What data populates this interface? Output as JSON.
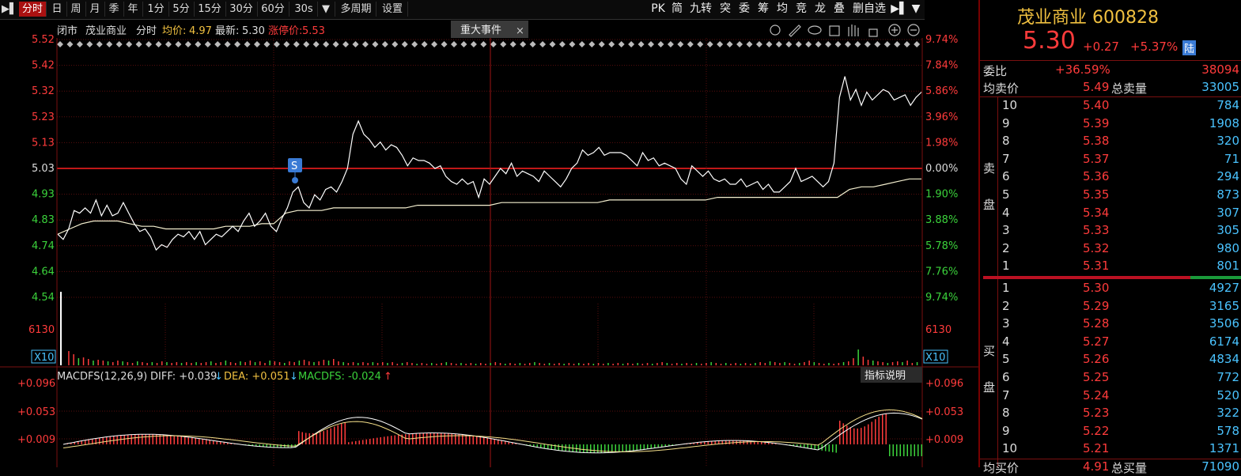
{
  "toolbar": {
    "left_tabs": [
      "分时",
      "日",
      "周",
      "月",
      "季",
      "年",
      "1分",
      "5分",
      "15分",
      "30分",
      "60分",
      "30s",
      "多周期",
      "设置"
    ],
    "right_tools": [
      "PK",
      "简",
      "九转",
      "突",
      "委",
      "筹",
      "均",
      "竞",
      "龙",
      "叠",
      "删自选"
    ]
  },
  "header": {
    "status": "闭市",
    "name": "茂业商业",
    "mode": "分时",
    "avg_label": "均价:",
    "avg_value": "4.97",
    "last_label": "最新:",
    "last_value": "5.30",
    "limit_up_label": "涨停价:",
    "limit_up_value": "5.53",
    "event_tab": "重大事件",
    "event_close": "×"
  },
  "price_axis": {
    "left": [
      "5.52",
      "5.42",
      "5.32",
      "5.23",
      "5.13",
      "5.03",
      "4.93",
      "4.83",
      "4.74",
      "4.64",
      "4.54"
    ],
    "right": [
      "9.74%",
      "7.84%",
      "5.86%",
      "3.96%",
      "1.98%",
      "0.00%",
      "1.90%",
      "3.88%",
      "5.78%",
      "7.76%",
      "9.74%"
    ],
    "volume_label": "6130",
    "volume_scale": "X10",
    "signal_badge": "S"
  },
  "macd": {
    "title": "MACDFS(12,26,9)",
    "diff_label": "DIFF: +0.039",
    "diff_arrow": "↓",
    "dea_label": "DEA: +0.051",
    "dea_arrow": "↓",
    "macdfs_label": "MACDFS: -0.024",
    "macdfs_arrow": "↑",
    "help_button": "指标说明",
    "axis": [
      "+0.096",
      "+0.053",
      "+0.009"
    ]
  },
  "quote": {
    "title": "茂业商业 600828",
    "price": "5.30",
    "change": "+0.27",
    "change_pct": "+5.37%",
    "badge": "陆",
    "wb_label": "委比",
    "wb_value": "+36.59%",
    "wb_volume": "38094",
    "avg_ask_label": "均卖价",
    "avg_ask_value": "5.49",
    "total_ask_label": "总卖量",
    "total_ask_value": "33005",
    "sell_label_1": "卖",
    "sell_label_2": "盘",
    "buy_label_1": "买",
    "buy_label_2": "盘",
    "bottom_left": "均买价",
    "bottom_mid": "4.91",
    "bottom_label": "总买量",
    "bottom_val": "71090",
    "asks": [
      {
        "level": "10",
        "price": "5.40",
        "vol": "784"
      },
      {
        "level": "9",
        "price": "5.39",
        "vol": "1908"
      },
      {
        "level": "8",
        "price": "5.38",
        "vol": "320"
      },
      {
        "level": "7",
        "price": "5.37",
        "vol": "71"
      },
      {
        "level": "6",
        "price": "5.36",
        "vol": "294"
      },
      {
        "level": "5",
        "price": "5.35",
        "vol": "873"
      },
      {
        "level": "4",
        "price": "5.34",
        "vol": "307"
      },
      {
        "level": "3",
        "price": "5.33",
        "vol": "305"
      },
      {
        "level": "2",
        "price": "5.32",
        "vol": "980"
      },
      {
        "level": "1",
        "price": "5.31",
        "vol": "801"
      }
    ],
    "bids": [
      {
        "level": "1",
        "price": "5.30",
        "vol": "4927"
      },
      {
        "level": "2",
        "price": "5.29",
        "vol": "3165"
      },
      {
        "level": "3",
        "price": "5.28",
        "vol": "3506"
      },
      {
        "level": "4",
        "price": "5.27",
        "vol": "6174"
      },
      {
        "level": "5",
        "price": "5.26",
        "vol": "4834"
      },
      {
        "level": "6",
        "price": "5.25",
        "vol": "772"
      },
      {
        "level": "7",
        "price": "5.24",
        "vol": "520"
      },
      {
        "level": "8",
        "price": "5.23",
        "vol": "322"
      },
      {
        "level": "9",
        "price": "5.22",
        "vol": "578"
      },
      {
        "level": "10",
        "price": "5.21",
        "vol": "1371"
      }
    ]
  },
  "chart_data": {
    "type": "line",
    "series": [
      {
        "values": [
          4.78,
          4.76,
          4.8,
          4.87,
          4.86,
          4.88,
          4.86,
          4.91,
          4.85,
          4.89,
          4.85,
          4.86,
          4.9,
          4.86,
          4.82,
          4.79,
          4.8,
          4.77,
          4.72,
          4.74,
          4.73,
          4.76,
          4.78,
          4.77,
          4.79,
          4.76,
          4.79,
          4.74,
          4.76,
          4.78,
          4.77,
          4.79,
          4.81,
          4.79,
          4.83,
          4.86,
          4.81,
          4.83,
          4.86,
          4.81,
          4.79,
          4.84,
          4.88,
          4.94,
          4.96,
          4.9,
          4.88,
          4.93,
          4.91,
          4.95,
          4.96,
          4.94,
          4.98,
          5.03,
          5.16,
          5.21,
          5.16,
          5.14,
          5.11,
          5.13,
          5.1,
          5.12,
          5.11,
          5.08,
          5.04,
          5.07,
          5.06,
          5.06,
          5.05,
          5.03,
          5.04,
          5.0,
          4.98,
          4.97,
          4.99,
          4.97,
          4.98,
          4.92,
          4.99,
          4.97,
          5.0,
          5.03,
          5.01,
          5.05,
          5.0,
          5.02,
          5.01,
          5.0,
          4.98,
          5.02,
          5.0,
          4.98,
          4.96,
          4.99,
          5.03,
          5.05,
          5.1,
          5.08,
          5.09,
          5.11,
          5.08,
          5.09,
          5.09,
          5.09,
          5.08,
          5.06,
          5.04,
          5.09,
          5.06,
          5.07,
          5.04,
          5.05,
          5.04,
          5.03,
          4.99,
          4.97,
          5.04,
          5.02,
          5.0,
          5.02,
          4.99,
          4.98,
          4.99,
          4.97,
          4.97,
          4.99,
          4.96,
          4.97,
          4.98,
          4.95,
          4.97,
          4.94,
          4.94,
          4.96,
          4.98,
          5.03,
          4.98,
          4.99,
          5.0,
          4.98,
          4.96,
          4.98,
          5.05,
          5.3,
          5.38,
          5.29,
          5.33,
          5.27,
          5.32,
          5.29,
          5.31,
          5.33,
          5.32,
          5.29,
          5.3,
          5.31,
          5.27,
          5.3,
          5.32
        ]
      },
      {
        "values": [
          4.78,
          4.8,
          4.82,
          4.83,
          4.83,
          4.83,
          4.82,
          4.81,
          4.81,
          4.8,
          4.8,
          4.8,
          4.8,
          4.8,
          4.81,
          4.81,
          4.81,
          4.82,
          4.82,
          4.86,
          4.87,
          4.87,
          4.87,
          4.88,
          4.88,
          4.88,
          4.88,
          4.88,
          4.88,
          4.88,
          4.89,
          4.89,
          4.89,
          4.89,
          4.89,
          4.89,
          4.89,
          4.9,
          4.9,
          4.9,
          4.9,
          4.9,
          4.9,
          4.9,
          4.9,
          4.9,
          4.91,
          4.91,
          4.91,
          4.91,
          4.91,
          4.91,
          4.91,
          4.91,
          4.91,
          4.92,
          4.92,
          4.92,
          4.92,
          4.92,
          4.92,
          4.92,
          4.92,
          4.92,
          4.92,
          4.92,
          4.95,
          4.96,
          4.96,
          4.97,
          4.98,
          4.99,
          4.99
        ]
      }
    ],
    "ylim": [
      4.54,
      5.52
    ]
  }
}
